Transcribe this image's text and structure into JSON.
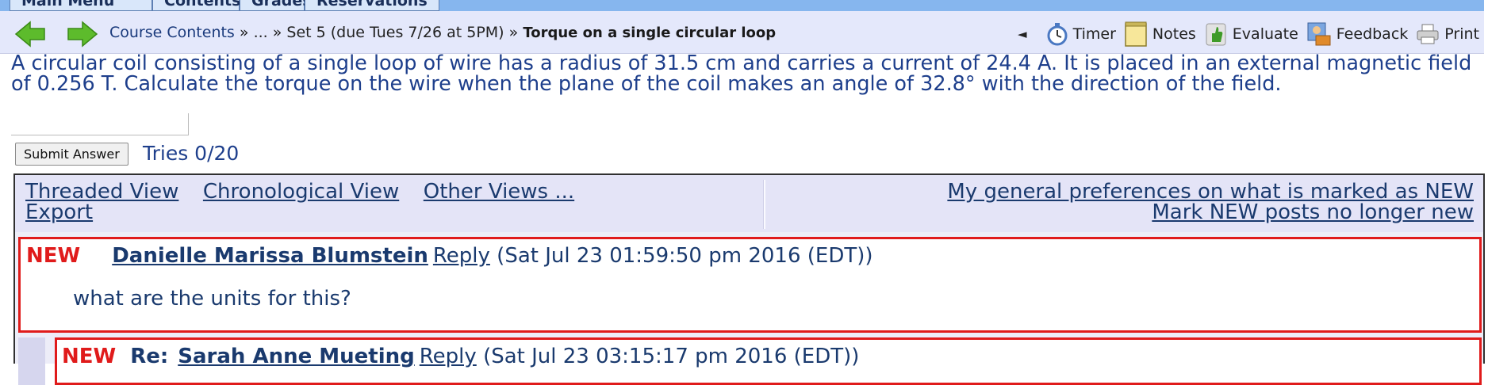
{
  "topnav": {
    "tabs": [
      {
        "label": "Main Menu"
      },
      {
        "label": "Contents"
      },
      {
        "label": "Grades"
      },
      {
        "label": "Reservations"
      }
    ]
  },
  "navbar": {
    "breadcrumb": {
      "course_contents": "Course Contents",
      "sep1": " » ",
      "ellipsis": "...",
      "sep2": " » ",
      "set": "Set 5 (due Tues 7/26 at 5PM)",
      "sep3": " » ",
      "current": "Torque on a single circular loop"
    },
    "collapse_glyph": "◄",
    "tools": {
      "timer": "Timer",
      "notes": "Notes",
      "evaluate": "Evaluate",
      "feedback": "Feedback",
      "print": "Print"
    }
  },
  "problem": {
    "text": "A circular coil consisting of a single loop of wire has a radius of 31.5 cm and carries a current of 24.4 A. It is placed in an external magnetic field of 0.256 T. Calculate the torque on the wire when the plane of the coil makes an angle of 32.8° with the direction of the field.",
    "answer_value": "",
    "submit_label": "Submit Answer",
    "tries": "Tries 0/20"
  },
  "discussion": {
    "views": {
      "threaded": "Threaded View",
      "chronological": "Chronological View",
      "other": "Other Views ...",
      "export": "Export"
    },
    "prefs": {
      "general": "My general preferences on what is marked as NEW",
      "mark_read": "Mark NEW posts no longer new"
    },
    "posts": [
      {
        "new_label": "NEW",
        "author": "Danielle Marissa Blumstein",
        "reply": "Reply",
        "date": "(Sat Jul 23 01:59:50 pm 2016 (EDT))",
        "body": "what are the units for this?"
      },
      {
        "new_label": "NEW",
        "re_prefix": "Re:",
        "author": "Sarah Anne Mueting",
        "reply": "Reply",
        "date": "(Sat Jul 23 03:15:17 pm 2016 (EDT))"
      }
    ]
  },
  "colors": {
    "tabbar": "#86b6ee",
    "navbar": "#e4e8fb",
    "question_text": "#1e3f8c",
    "new_border": "#e01b1b"
  }
}
